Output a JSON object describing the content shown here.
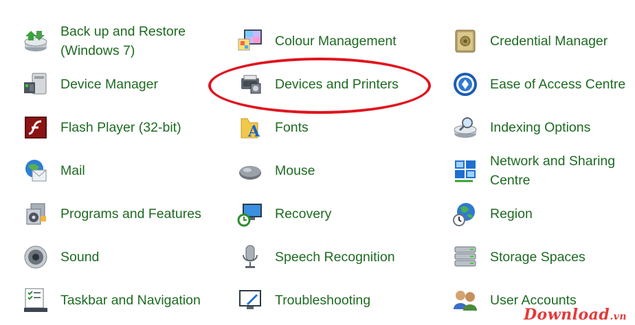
{
  "items": [
    {
      "label": "Back up and Restore (Windows 7)",
      "label_lines": [
        "Back up and Restore",
        "(Windows 7)"
      ],
      "icon": "backup-restore-icon"
    },
    {
      "label": "Colour Management",
      "icon": "colour-management-icon"
    },
    {
      "label": "Credential Manager",
      "icon": "credential-manager-icon"
    },
    {
      "label": "Device Manager",
      "icon": "device-manager-icon"
    },
    {
      "label": "Devices and Printers",
      "icon": "devices-printers-icon"
    },
    {
      "label": "Ease of Access Centre",
      "icon": "ease-of-access-icon"
    },
    {
      "label": "Flash Player (32-bit)",
      "icon": "flash-player-icon"
    },
    {
      "label": "Fonts",
      "icon": "fonts-icon"
    },
    {
      "label": "Indexing Options",
      "icon": "indexing-options-icon"
    },
    {
      "label": "Mail",
      "icon": "mail-icon"
    },
    {
      "label": "Mouse",
      "icon": "mouse-icon"
    },
    {
      "label": "Network and Sharing Centre",
      "label_lines": [
        "Network and Sharing",
        "Centre"
      ],
      "icon": "network-sharing-icon"
    },
    {
      "label": "Programs and Features",
      "icon": "programs-features-icon"
    },
    {
      "label": "Recovery",
      "icon": "recovery-icon"
    },
    {
      "label": "Region",
      "icon": "region-icon"
    },
    {
      "label": "Sound",
      "icon": "sound-icon"
    },
    {
      "label": "Speech Recognition",
      "icon": "speech-recognition-icon"
    },
    {
      "label": "Storage Spaces",
      "icon": "storage-spaces-icon"
    },
    {
      "label": "Taskbar and Navigation",
      "icon": "taskbar-navigation-icon"
    },
    {
      "label": "Troubleshooting",
      "icon": "troubleshooting-icon"
    },
    {
      "label": "User Accounts",
      "icon": "user-accounts-icon"
    }
  ],
  "highlighted_item": "Devices and Printers",
  "watermark": {
    "brand": "Download",
    "tld": ".vn"
  },
  "colors": {
    "link": "#1e6a22",
    "highlight": "#e0141e",
    "watermark": "#e43a3a"
  }
}
